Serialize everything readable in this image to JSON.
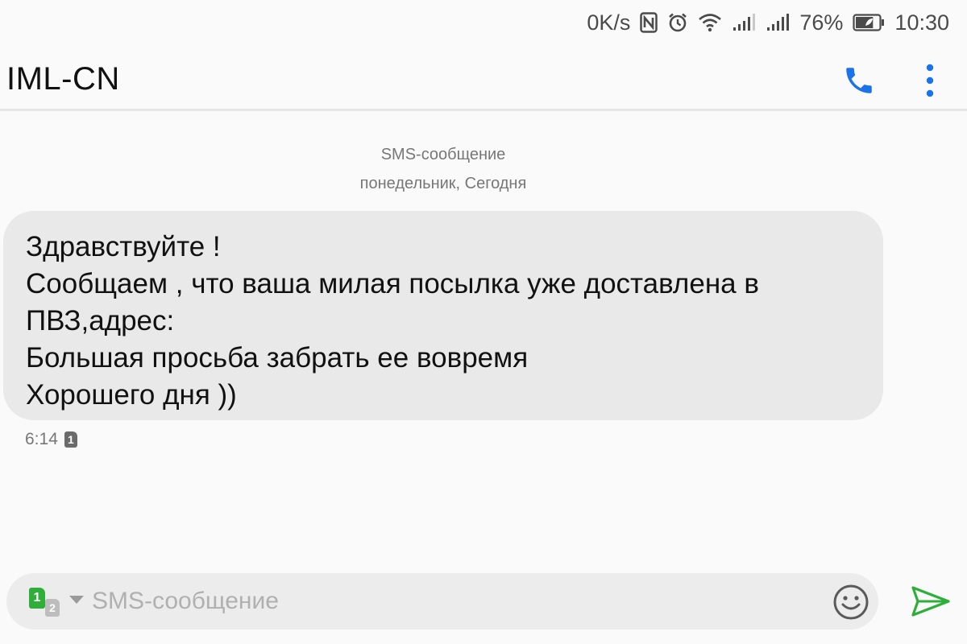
{
  "status_bar": {
    "net_speed": "0K/s",
    "nfc_icon": "nfc-icon",
    "alarm_icon": "alarm-icon",
    "wifi_icon": "wifi-icon",
    "signal_icon": "cell-signal-icon",
    "battery_percent": "76%",
    "battery_level": 0.76,
    "time": "10:30"
  },
  "header": {
    "contact_name": "IML-CN",
    "call_icon": "phone-icon",
    "more_icon": "more-vertical-icon",
    "accent_color": "#1a73e8"
  },
  "conversation": {
    "message_type_label": "SMS-сообщение",
    "date_label": "понедельник, Сегодня",
    "messages": [
      {
        "lines": [
          "Здравствуйте !",
          "Сообщаем , что ваша милая посылка уже доставлена в",
          "ПВЗ,адрес:",
          "Большая просьба забрать ее вовремя",
          "Хорошего дня ))"
        ],
        "time": "6:14",
        "sim": "1"
      }
    ]
  },
  "composer": {
    "sim_active": "1",
    "sim_inactive": "2",
    "sim_active_color": "#2fae3a",
    "placeholder": "SMS-сообщение",
    "emoji_icon": "emoji-icon",
    "send_icon": "send-icon",
    "send_color": "#2fae3a"
  }
}
